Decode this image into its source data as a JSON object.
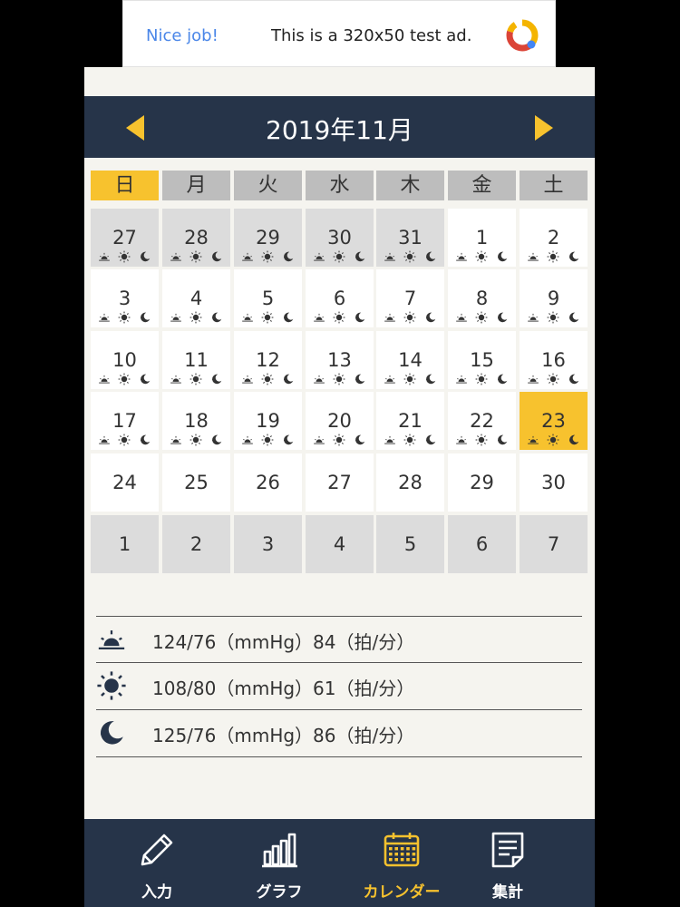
{
  "ad": {
    "headline": "Nice job!",
    "message": "This is a 320x50 test ad.",
    "logo_icon": "google-ad-logo"
  },
  "header": {
    "month_title": "2019年11月",
    "prev_icon": "triangle-left-icon",
    "next_icon": "triangle-right-icon"
  },
  "calendar": {
    "weekdays": [
      "日",
      "月",
      "火",
      "水",
      "木",
      "金",
      "土"
    ],
    "weeks": [
      [
        {
          "day": "27",
          "gray": true,
          "icons": true
        },
        {
          "day": "28",
          "gray": true,
          "icons": true
        },
        {
          "day": "29",
          "gray": true,
          "icons": true
        },
        {
          "day": "30",
          "gray": true,
          "icons": true
        },
        {
          "day": "31",
          "gray": true,
          "icons": true
        },
        {
          "day": "1",
          "icons": true
        },
        {
          "day": "2",
          "icons": true
        }
      ],
      [
        {
          "day": "3",
          "icons": true
        },
        {
          "day": "4",
          "icons": true
        },
        {
          "day": "5",
          "icons": true
        },
        {
          "day": "6",
          "icons": true
        },
        {
          "day": "7",
          "icons": true
        },
        {
          "day": "8",
          "icons": true
        },
        {
          "day": "9",
          "icons": true
        }
      ],
      [
        {
          "day": "10",
          "icons": true
        },
        {
          "day": "11",
          "icons": true
        },
        {
          "day": "12",
          "icons": true
        },
        {
          "day": "13",
          "icons": true
        },
        {
          "day": "14",
          "icons": true
        },
        {
          "day": "15",
          "icons": true
        },
        {
          "day": "16",
          "icons": true
        }
      ],
      [
        {
          "day": "17",
          "icons": true
        },
        {
          "day": "18",
          "icons": true
        },
        {
          "day": "19",
          "icons": true
        },
        {
          "day": "20",
          "icons": true
        },
        {
          "day": "21",
          "icons": true
        },
        {
          "day": "22",
          "icons": true
        },
        {
          "day": "23",
          "icons": true,
          "selected": true
        }
      ],
      [
        {
          "day": "24"
        },
        {
          "day": "25"
        },
        {
          "day": "26"
        },
        {
          "day": "27"
        },
        {
          "day": "28"
        },
        {
          "day": "29"
        },
        {
          "day": "30"
        }
      ],
      [
        {
          "day": "1",
          "gray": true
        },
        {
          "day": "2",
          "gray": true
        },
        {
          "day": "3",
          "gray": true
        },
        {
          "day": "4",
          "gray": true
        },
        {
          "day": "5",
          "gray": true
        },
        {
          "day": "6",
          "gray": true
        },
        {
          "day": "7",
          "gray": true
        }
      ]
    ],
    "cell_icons": [
      "sunrise-icon",
      "sun-icon",
      "moon-icon"
    ]
  },
  "summary": {
    "rows": [
      {
        "icon": "sunrise-icon",
        "text": "124/76（mmHg）84（拍/分）"
      },
      {
        "icon": "sun-icon",
        "text": "108/80（mmHg）61（拍/分）"
      },
      {
        "icon": "moon-icon",
        "text": "125/76（mmHg）86（拍/分）"
      }
    ]
  },
  "nav": {
    "items": [
      {
        "label": "入力",
        "icon": "pencil-icon",
        "active": false
      },
      {
        "label": "グラフ",
        "icon": "bar-chart-icon",
        "active": false
      },
      {
        "label": "カレンダー",
        "icon": "calendar-icon",
        "active": true
      },
      {
        "label": "集計",
        "icon": "document-icon",
        "active": false
      }
    ]
  },
  "colors": {
    "navy": "#263449",
    "accent": "#f7c22e",
    "cell_gray": "#dcdcdc",
    "weekday_gray": "#bdbdbd",
    "background": "#f5f4ef"
  }
}
